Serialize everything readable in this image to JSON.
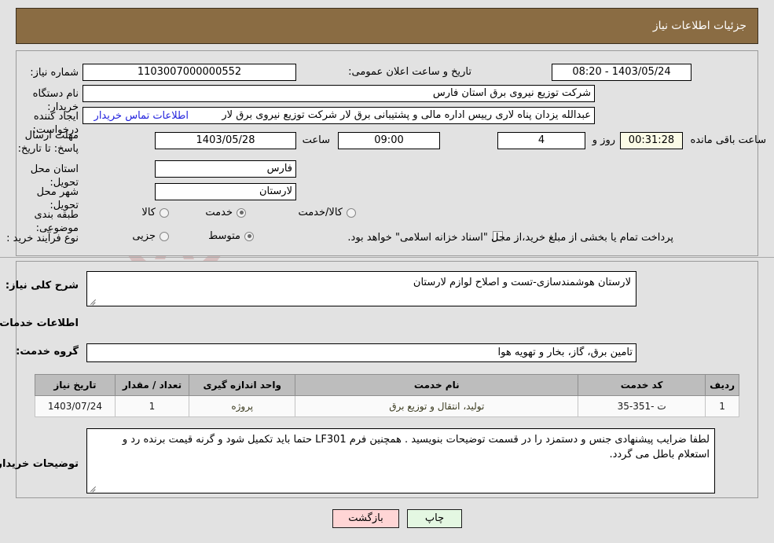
{
  "header": {
    "title": "جزئیات اطلاعات نیاز"
  },
  "form": {
    "need_number_label": "شماره نیاز:",
    "need_number_value": "1103007000000552",
    "announce_label": "تاریخ و ساعت اعلان عمومی:",
    "announce_value": "1403/05/24 - 08:20",
    "buyer_org_label": "نام دستگاه خریدار:",
    "buyer_org_value": "شرکت توزیع نیروی برق استان فارس",
    "requester_label": "ایجاد کننده درخواست:",
    "requester_value": "عبدالله یزدان پناه لاری رییس اداره مالی و پشتیبانی برق لار شرکت توزیع نیروی برق لار",
    "contact_link": "اطلاعات تماس خریدار",
    "deadline_label": "مهلت ارسال پاسخ: تا تاریخ:",
    "deadline_date": "1403/05/28",
    "deadline_time_label": "ساعت",
    "deadline_time": "09:00",
    "days_value": "4",
    "days_label": "روز و",
    "countdown_value": "00:31:28",
    "countdown_label": "ساعت باقی مانده",
    "province_label": "استان محل تحویل:",
    "province_value": "فارس",
    "city_label": "شهر محل تحویل:",
    "city_value": "لارستان",
    "category_label": "طبقه بندی موضوعی:",
    "category_options": [
      {
        "label": "کالا",
        "selected": false
      },
      {
        "label": "خدمت",
        "selected": true
      },
      {
        "label": "کالا/خدمت",
        "selected": false
      }
    ],
    "process_label": "نوع فرآیند خرید :",
    "process_options": [
      {
        "label": "جزیی",
        "selected": false
      },
      {
        "label": "متوسط",
        "selected": true
      }
    ],
    "treasury_checkbox_label": "پرداخت تمام یا بخشی از مبلغ خرید،از محل \"اسناد خزانه اسلامی\" خواهد بود.",
    "treasury_checked": false
  },
  "summary": {
    "label": "شرح کلی نیاز:",
    "value": "لارستان هوشمندسازی-تست و اصلاح لوازم لارستان"
  },
  "services_section": {
    "title": "اطلاعات خدمات مورد نیاز",
    "group_label": "گروه خدمت:",
    "group_value": "تامین برق، گاز، بخار و تهویه هوا"
  },
  "table": {
    "columns": [
      "ردیف",
      "کد خدمت",
      "نام خدمت",
      "واحد اندازه گیری",
      "تعداد / مقدار",
      "تاریخ نیاز"
    ],
    "rows": [
      {
        "row": "1",
        "code": "ت -351-35",
        "name": "تولید، انتقال و توزیع برق",
        "unit": "پروژه",
        "qty": "1",
        "date": "1403/07/24"
      }
    ]
  },
  "buyer_notes": {
    "label": "توضیحات خریدار:",
    "value": "لطفا ضرایب پیشنهادی جنس و دستمزد را در قسمت توضیحات بنویسید . همچنین فرم LF301 حتما باید تکمیل شود و گرنه قیمت برنده رد و استعلام باطل می گردد."
  },
  "buttons": {
    "back": "بازگشت",
    "print": "چاپ"
  },
  "watermark": {
    "text": "AriaTender.net"
  },
  "colors": {
    "header_bg": "#8a6c43",
    "page_bg": "#e2e2e2",
    "link": "#2222dd",
    "back_btn": "#ffd5d5",
    "print_btn": "#e4f7e2",
    "countdown_bg": "#fbfbe6"
  }
}
